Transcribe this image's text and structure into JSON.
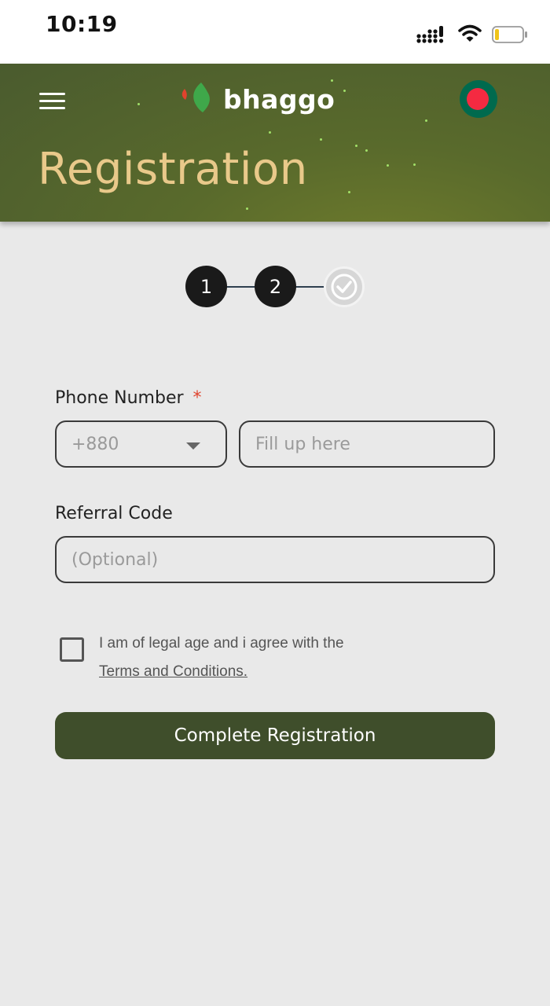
{
  "status_bar": {
    "time": "10:19",
    "icons": [
      "signal-icon",
      "wifi-icon",
      "battery-icon"
    ]
  },
  "header": {
    "menu_icon": "hamburger-menu-icon",
    "brand": "bhaggo",
    "country_flag": "bangladesh-flag-icon",
    "title": "Registration"
  },
  "stepper": {
    "steps": [
      "1",
      "2"
    ],
    "final_icon": "check-icon"
  },
  "form": {
    "phone_label": "Phone Number",
    "required_mark": "*",
    "country_code": "+880",
    "phone_placeholder": "Fill up here",
    "referral_label": "Referral Code",
    "referral_placeholder": "(Optional)",
    "agree_text": "I am of legal age and i agree with the",
    "terms_link": "Terms and Conditions.",
    "submit_label": "Complete Registration"
  },
  "colors": {
    "header_bg": "#596a2c",
    "title_color": "#e9c98a",
    "button_bg": "#3f4e2b",
    "required": "#e0432d",
    "page_bg": "#e9e9e9"
  }
}
